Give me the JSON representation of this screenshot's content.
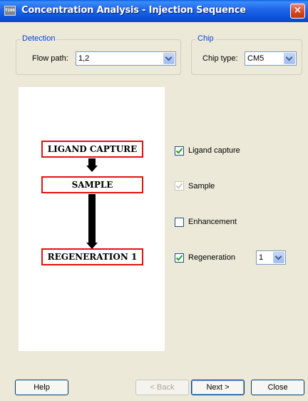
{
  "window": {
    "title": "Concentration Analysis - Injection Sequence",
    "app_icon_text": "T200",
    "close_glyph": "✕"
  },
  "detection": {
    "group_label": "Detection",
    "flow_path_label": "Flow path:",
    "flow_path_value": "1,2"
  },
  "chip": {
    "group_label": "Chip",
    "chip_type_label": "Chip type:",
    "chip_type_value": "CM5"
  },
  "diagram": {
    "steps": [
      "LIGAND CAPTURE",
      "SAMPLE",
      "REGENERATION 1"
    ],
    "box_color": "#e41111"
  },
  "options": [
    {
      "label": "Ligand capture",
      "checked": true,
      "enabled": true
    },
    {
      "label": "Sample",
      "checked": true,
      "enabled": false
    },
    {
      "label": "Enhancement",
      "checked": false,
      "enabled": true
    },
    {
      "label": "Regeneration",
      "checked": true,
      "enabled": true
    }
  ],
  "regeneration_count": "1",
  "buttons": {
    "help": "Help",
    "back": "< Back",
    "next": "Next >",
    "close": "Close"
  }
}
